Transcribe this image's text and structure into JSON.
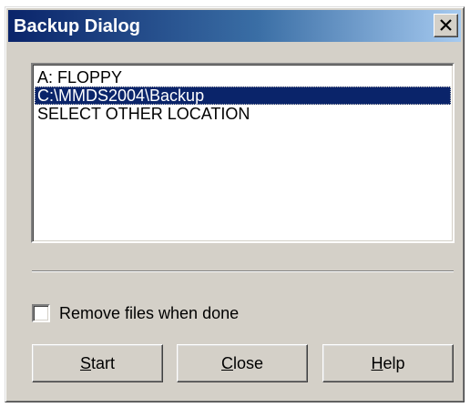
{
  "window": {
    "title": "Backup Dialog",
    "close_glyph": "close-x-icon"
  },
  "locations": {
    "items": [
      {
        "label": "A: FLOPPY",
        "selected": false
      },
      {
        "label": "C:\\MMDS2004\\Backup",
        "selected": true
      },
      {
        "label": "SELECT OTHER LOCATION",
        "selected": false
      }
    ]
  },
  "options": {
    "remove_files_label": "Remove files when done",
    "remove_files_checked": false
  },
  "buttons": {
    "start": {
      "accel": "S",
      "rest": "tart"
    },
    "close": {
      "accel": "C",
      "rest": "lose"
    },
    "help": {
      "accel": "H",
      "rest": "elp"
    }
  },
  "colors": {
    "title_gradient_start": "#0a246a",
    "title_gradient_end": "#a6caf0",
    "selection": "#0a246a",
    "face": "#d4d0c8"
  }
}
